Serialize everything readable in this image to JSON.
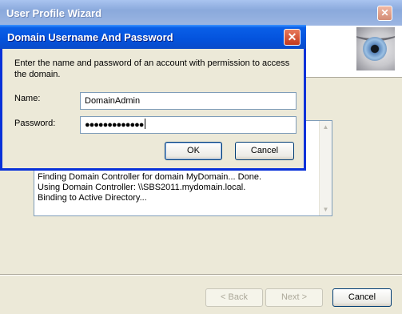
{
  "wizard": {
    "title": "User Profile Wizard",
    "close_glyph": "✕",
    "log_lines": [
      "Finding Domain Controller for domain MyDomain... Done.",
      "Using Domain Controller: \\\\SBS2011.mydomain.local.",
      "Binding to Active Directory..."
    ],
    "buttons": {
      "back": "< Back",
      "next": "Next >",
      "cancel": "Cancel"
    }
  },
  "dialog": {
    "title": "Domain Username And Password",
    "close_glyph": "✕",
    "message": "Enter the name and password of an account with permission to access the domain.",
    "name_label": "Name:",
    "name_value": "DomainAdmin",
    "password_label": "Password:",
    "password_value": "●●●●●●●●●●●●●",
    "ok_label": "OK",
    "cancel_label": "Cancel"
  },
  "icons": {
    "wizard_close": "close-icon",
    "dialog_close": "close-icon",
    "banner_image": "eye-icon"
  }
}
